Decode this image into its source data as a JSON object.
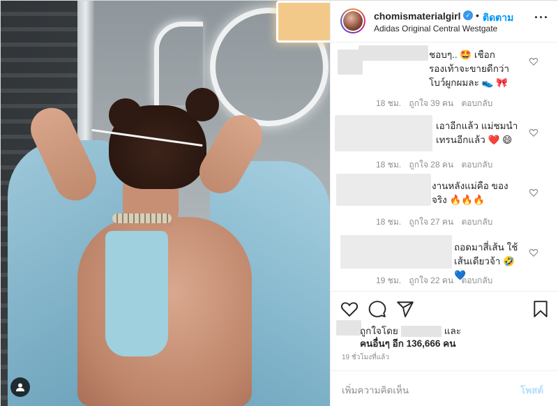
{
  "header": {
    "username": "chomismaterialgirl",
    "separator": "•",
    "follow_label": "ติดตาม",
    "location": "Adidas Original Central Westgate",
    "more_icon": "more-options-icon"
  },
  "comments": [
    {
      "text": "ชอบๆ.. 🤩 เชือกรองเท้าจะขายดีกว่าโบว์ผูกผมละ 👟 🎀",
      "time": "18 ชม.",
      "likes": "ถูกใจ 39 คน",
      "reply": "ตอบกลับ"
    },
    {
      "text": "เอาอีกแล้ว แม่ชมนำเทรนอีกแล้ว ❤️ 😄",
      "time": "18 ชม.",
      "likes": "ถูกใจ 28 คน",
      "reply": "ตอบกลับ"
    },
    {
      "text": "งานหลังแม่คือ ของจริง 🔥🔥🔥",
      "time": "18 ชม.",
      "likes": "ถูกใจ 27 คน",
      "reply": "ตอบกลับ"
    },
    {
      "text": "ถอดมาสี่เส้น ใช้เส้นเดียวจ้า 🤣💙",
      "time": "19 ชม.",
      "likes": "ถูกใจ 22 คน",
      "reply": "ตอบกลับ"
    }
  ],
  "likes": {
    "prefix": "ถูกใจโดย",
    "conj": "และ",
    "others": "คนอื่นๆ อีก 136,666 คน"
  },
  "time_ago": "19 ชั่วโมงที่แล้ว",
  "composer": {
    "placeholder": "เพิ่มความคิดเห็น",
    "post_label": "โพสต์"
  },
  "colors": {
    "follow": "#0095f6",
    "verified": "#3897f0",
    "post_disabled": "#b2dffc"
  }
}
